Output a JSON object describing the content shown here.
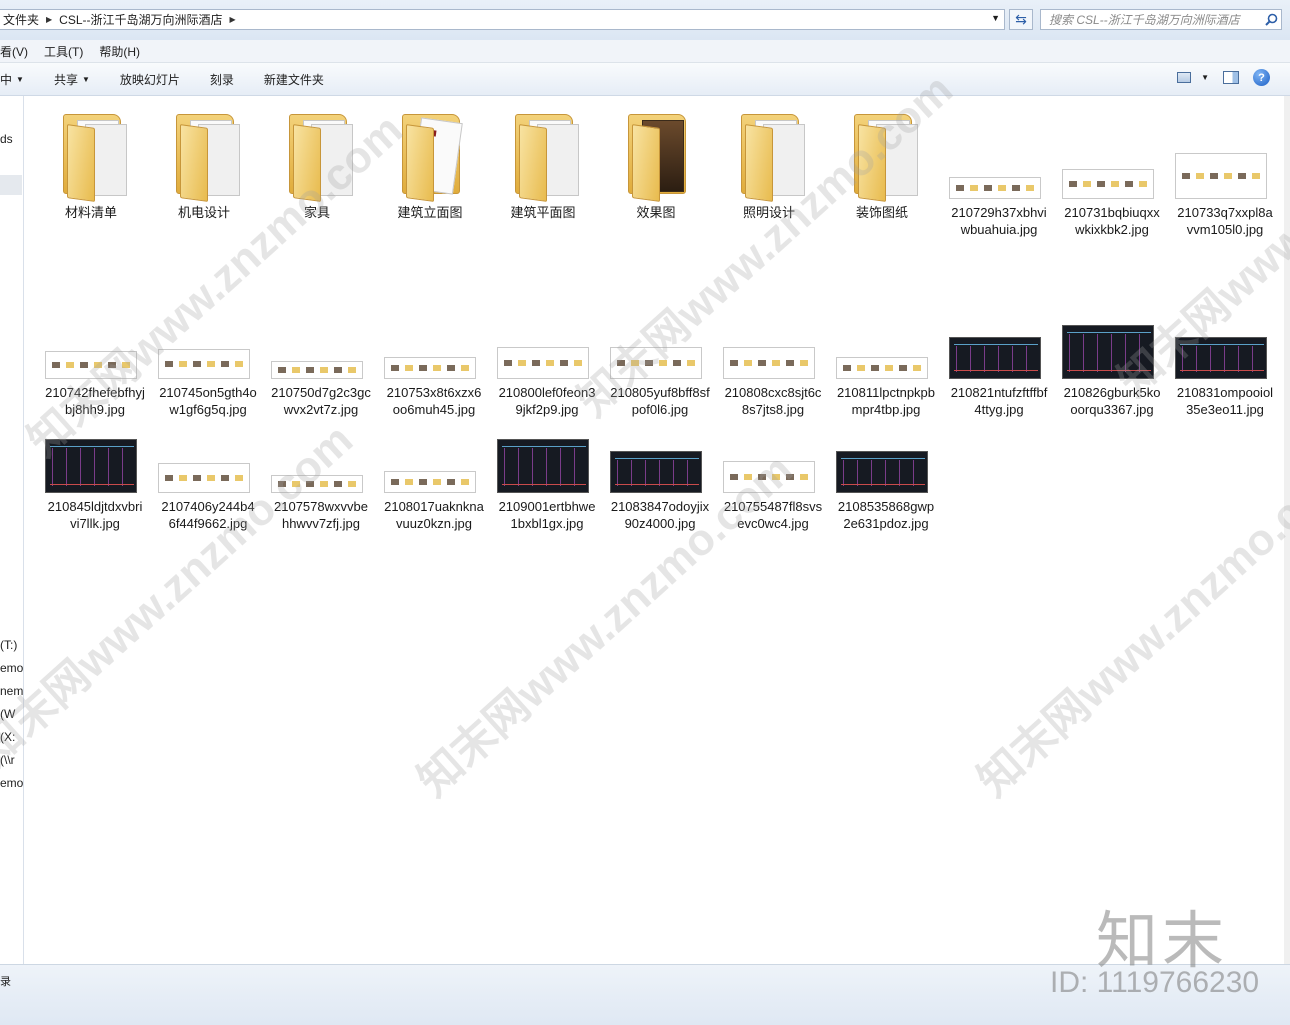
{
  "address": {
    "crumbs": [
      "文件夹",
      "CSL--浙江千岛湖万向洲际酒店"
    ]
  },
  "search": {
    "placeholder": "搜索 CSL--浙江千岛湖万向洲际酒店"
  },
  "menu": [
    "看(V)",
    "工具(T)",
    "帮助(H)"
  ],
  "toolbar": {
    "include": "中",
    "share": "共享",
    "slideshow": "放映幻灯片",
    "burn": "刻录",
    "new_folder": "新建文件夹"
  },
  "nav": [
    "ds",
    "(T:)",
    "emo",
    "nemo",
    "(W",
    "(X:",
    "(\\\\r",
    "emo"
  ],
  "folders": [
    {
      "name": "材料清单",
      "kind": "docs"
    },
    {
      "name": "机电设计",
      "kind": "docs"
    },
    {
      "name": "家具",
      "kind": "pages"
    },
    {
      "name": "建筑立面图",
      "kind": "sheet"
    },
    {
      "name": "建筑平面图",
      "kind": "docs"
    },
    {
      "name": "效果图",
      "kind": "photo"
    },
    {
      "name": "照明设计",
      "kind": "docs"
    },
    {
      "name": "装饰图纸",
      "kind": "docs"
    }
  ],
  "files": [
    {
      "name": "210729h37xbhviwbuahuia.jpg",
      "style": "light"
    },
    {
      "name": "210731bqbiuqxxwkixkbk2.jpg",
      "style": "light"
    },
    {
      "name": "210733q7xxpl8avvm105l0.jpg",
      "style": "light"
    },
    {
      "name": "210742fhefebfhyjbj8hh9.jpg",
      "style": "light"
    },
    {
      "name": "210745on5gth4ow1gf6g5q.jpg",
      "style": "light"
    },
    {
      "name": "210750d7g2c3gcwvx2vt7z.jpg",
      "style": "light"
    },
    {
      "name": "210753x8t6xzx6oo6muh45.jpg",
      "style": "light"
    },
    {
      "name": "210800lef0feon39jkf2p9.jpg",
      "style": "light"
    },
    {
      "name": "210805yuf8bff8sfpof0l6.jpg",
      "style": "light"
    },
    {
      "name": "210808cxc8sjt6c8s7jts8.jpg",
      "style": "light"
    },
    {
      "name": "210811lpctnpkpbmpr4tbp.jpg",
      "style": "light"
    },
    {
      "name": "210821ntufzftffbf4ttyg.jpg",
      "style": "dark"
    },
    {
      "name": "210826gburk5kooorqu3367.jpg",
      "style": "dark"
    },
    {
      "name": "210831ompooiol35e3eo11.jpg",
      "style": "dark"
    },
    {
      "name": "210845ldjtdxvbrivi7llk.jpg",
      "style": "dark"
    },
    {
      "name": "2107406y244b46f44f9662.jpg",
      "style": "light"
    },
    {
      "name": "2107578wxvvbehhwvv7zfj.jpg",
      "style": "light"
    },
    {
      "name": "2108017uaknknavuuz0kzn.jpg",
      "style": "light"
    },
    {
      "name": "2109001ertbhwe1bxbl1gx.jpg",
      "style": "dark"
    },
    {
      "name": "21083847odoyjix90z4000.jpg",
      "style": "dark"
    },
    {
      "name": "210755487fl8svsevc0wc4.jpg",
      "style": "light"
    },
    {
      "name": "2108535868gwp2e631pdoz.jpg",
      "style": "dark"
    }
  ],
  "status": {
    "text": "录"
  },
  "watermark": {
    "site": "知末网www.znzmo.com",
    "brand": "知末",
    "id": "ID: 1119766230"
  }
}
